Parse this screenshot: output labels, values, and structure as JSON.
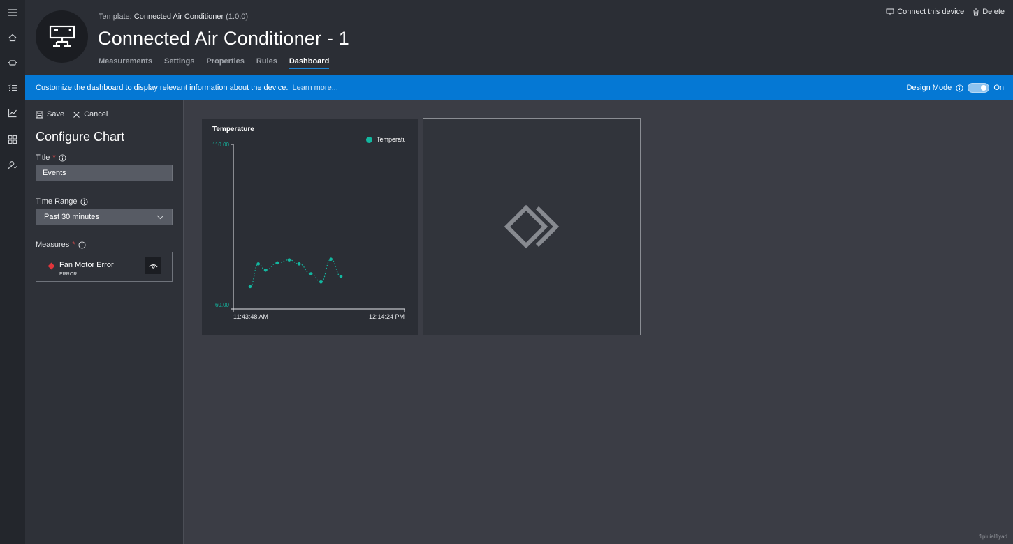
{
  "nav": {
    "icons": [
      "hamburger-icon",
      "home-icon",
      "device-icon",
      "rules-list-icon",
      "analytics-icon",
      "dashboard-grid-icon",
      "user-admin-icon"
    ]
  },
  "header": {
    "template_label": "Template:",
    "template_name": "Connected Air Conditioner",
    "template_version": "(1.0.0)",
    "device_name": "Connected Air Conditioner - 1",
    "tabs": [
      {
        "label": "Measurements",
        "active": false
      },
      {
        "label": "Settings",
        "active": false
      },
      {
        "label": "Properties",
        "active": false
      },
      {
        "label": "Rules",
        "active": false
      },
      {
        "label": "Dashboard",
        "active": true
      }
    ],
    "connect_label": "Connect this device",
    "delete_label": "Delete"
  },
  "banner": {
    "message": "Customize the dashboard to display relevant information about the device.",
    "link": "Learn more...",
    "design_mode_label": "Design Mode",
    "design_mode_state": "On",
    "color": "#0578d4"
  },
  "config": {
    "save_label": "Save",
    "cancel_label": "Cancel",
    "heading": "Configure Chart",
    "title_label": "Title",
    "title_value": "Events",
    "time_range_label": "Time Range",
    "time_range_value": "Past 30 minutes",
    "measures_label": "Measures",
    "measure": {
      "name": "Fan Motor Error",
      "type": "ERROR",
      "color": "#e0353b"
    }
  },
  "chart_data": {
    "type": "line",
    "title": "Temperature",
    "series": [
      {
        "name": "Temperature",
        "color": "#13b7a0",
        "x": [
          0,
          0.09,
          0.17,
          0.3,
          0.43,
          0.54,
          0.67,
          0.78,
          0.89,
          1.0
        ],
        "values": [
          66.8,
          73.7,
          71.8,
          74.0,
          74.9,
          73.7,
          70.7,
          68.2,
          75.1,
          69.9
        ]
      }
    ],
    "ylim": [
      60,
      110
    ],
    "ytick_labels": [
      "110.00",
      "60.00"
    ],
    "xtick_labels": [
      "11:43:48 AM",
      "12:14:24 PM"
    ],
    "legend": "top-right"
  },
  "footer": {
    "tag": "1pluial1yad"
  }
}
